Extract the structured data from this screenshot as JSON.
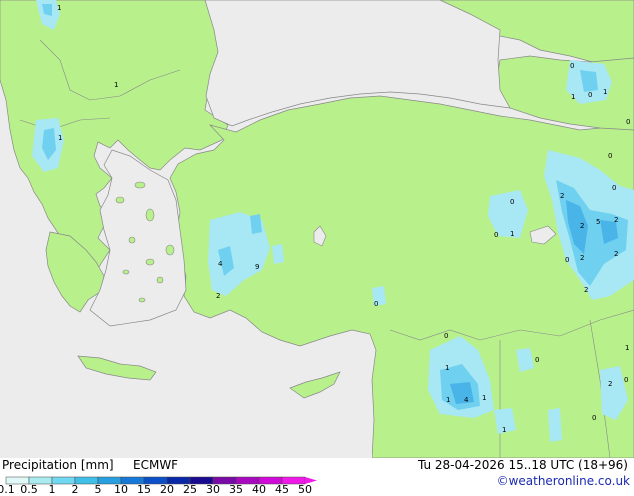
{
  "footer": {
    "title": "Precipitation [mm]",
    "model": "ECMWF",
    "valid_time": "Tu 28-04-2026 15..18 UTC (18+96)",
    "credit": "©weatheronline.co.uk"
  },
  "legend": {
    "labels": [
      "0.1",
      "0.5",
      "1",
      "2",
      "5",
      "10",
      "15",
      "20",
      "25",
      "30",
      "35",
      "40",
      "45",
      "50"
    ],
    "colors": [
      "#e0f8f8",
      "#a8ecf0",
      "#70d8f0",
      "#40c0e8",
      "#28a0e0",
      "#1878d8",
      "#0c50c8",
      "#0828a8",
      "#1a0a90",
      "#7a0aa8",
      "#a80ac0",
      "#d00ad8",
      "#f01ae8"
    ]
  },
  "colors": {
    "land": "#b8f08c",
    "sea": "#ececec",
    "border": "#888888",
    "precip_light": "#a8e8f4",
    "precip_mid": "#70d0f0",
    "precip_strong": "#48b4e8"
  },
  "map_labels": [
    "1",
    "1",
    "1",
    "4",
    "9",
    "2",
    "0",
    "0",
    "1",
    "0",
    "1",
    "0",
    "1",
    "0",
    "0",
    "0",
    "2",
    "2",
    "5",
    "2",
    "2",
    "0",
    "2",
    "2",
    "0",
    "1",
    "1",
    "4",
    "1",
    "0",
    "1",
    "1",
    "0",
    "2",
    "0",
    "0"
  ]
}
